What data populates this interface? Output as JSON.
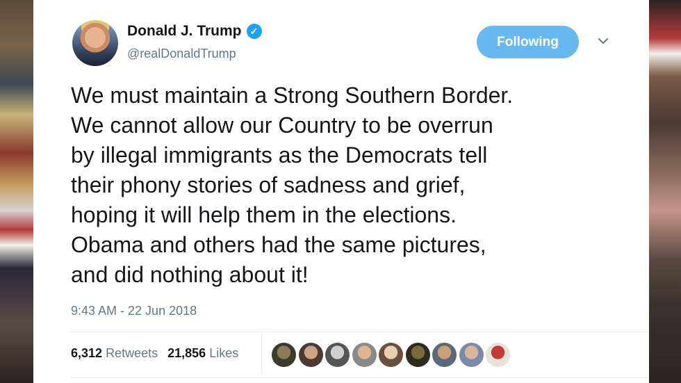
{
  "tweet": {
    "author_name": "Donald J. Trump",
    "handle": "@realDonaldTrump",
    "verified_icon": "verified-badge-icon",
    "follow_button": "Following",
    "text_lines": [
      "We must maintain a Strong Southern Border.",
      "We cannot allow our Country to be overrun",
      "by illegal immigrants as the Democrats tell",
      "their phony stories of sadness and grief,",
      "hoping it will help them in the elections.",
      "Obama and others had the same pictures,",
      "and did nothing about it!"
    ],
    "timestamp": "9:43 AM - 22 Jun 2018",
    "retweets_count": "6,312",
    "retweets_label": "Retweets",
    "likes_count": "21,856",
    "likes_label": "Likes"
  },
  "colors": {
    "accent": "#1da1f2",
    "follow_button": "#67b8ee",
    "secondary_text": "#657786",
    "primary_text": "#14171a"
  }
}
